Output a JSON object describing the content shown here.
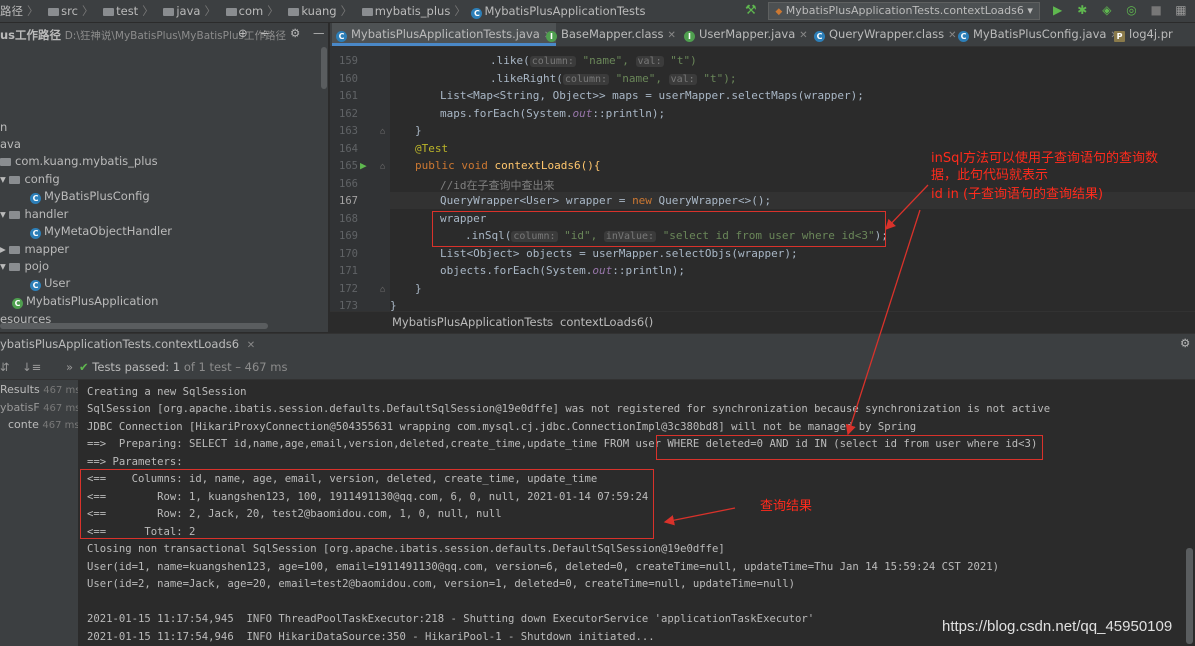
{
  "navbar": {
    "crumbs": [
      "路径",
      "src",
      "test",
      "java",
      "com",
      "kuang",
      "mybatis_plus",
      "MybatisPlusApplicationTests"
    ],
    "run_config": "MybatisPlusApplicationTests.contextLoads6"
  },
  "project": {
    "header": "us工作路径",
    "header_path": "D:\\狂神说\\MyBatisPlus\\MyBatisPlus工作路径",
    "items": [
      "n",
      "ava",
      "com.kuang.mybatis_plus",
      "config",
      "MyBatisPlusConfig",
      "handler",
      "MyMetaObjectHandler",
      "mapper",
      "pojo",
      "User",
      "MybatisPlusApplication",
      "esources"
    ]
  },
  "tabs": [
    {
      "label": "MybatisPlusApplicationTests.java",
      "icon": "C"
    },
    {
      "label": "BaseMapper.class",
      "icon": "I"
    },
    {
      "label": "UserMapper.java",
      "icon": "I"
    },
    {
      "label": "QueryWrapper.class",
      "icon": "C"
    },
    {
      "label": "MyBatisPlusConfig.java",
      "icon": "C"
    },
    {
      "label": "log4j.pr",
      "icon": "P"
    }
  ],
  "editor": {
    "line_numbers": [
      "159",
      "160",
      "161",
      "162",
      "163",
      "164",
      "165",
      "166",
      "167",
      "168",
      "169",
      "170",
      "171",
      "172",
      "173"
    ],
    "lines": {
      "l159a": ".like(",
      "l159h": "column:",
      "l159s1": "\"name\",",
      "l159h2": "val:",
      "l159s2": "\"t\")",
      "l160a": ".likeRight(",
      "l160h": "column:",
      "l160s1": "\"name\",",
      "l160h2": "val:",
      "l160s2": "\"t\");",
      "l161": "List<Map<String, Object>> maps = userMapper.selectMaps(wrapper);",
      "l162a": "maps.forEach(System.",
      "l162f": "out",
      "l162b": "::println);",
      "l163": "}",
      "l164": "@Test",
      "l165k": "public void",
      "l165": " contextLoads6(){",
      "l166": "//id在子查询中查出来",
      "l167a": "QueryWrapper<User> wrapper = ",
      "l167k": "new",
      "l167b": " QueryWrapper<>();",
      "l168": "wrapper",
      "l169a": ".inSql(",
      "l169h": "column:",
      "l169s1": "\"id\",",
      "l169h2": "inValue:",
      "l169s2": "\"select id from user where id<3\"",
      "l169b": ");",
      "l170": "List<Object> objects = userMapper.selectObjs(wrapper);",
      "l171a": "objects.forEach(System.",
      "l171f": "out",
      "l171b": "::println);",
      "l172": "}",
      "l173": "}"
    },
    "breadcrumb": [
      "MybatisPlusApplicationTests",
      "contextLoads6()"
    ]
  },
  "annotation": {
    "line1": "inSql方法可以使用子查询语句的查询数",
    "line2": "据，此句代码就表示",
    "line3": "id in (子查询语句的查询结果)",
    "result_label": "查询结果"
  },
  "run": {
    "tab": "ybatisPlusApplicationTests.contextLoads6",
    "status_label": "Tests passed:",
    "status_count": "1",
    "status_rest": "of 1 test – 467 ms",
    "tree": [
      {
        "label": "Results",
        "time": "467 ms"
      },
      {
        "label": "ybatisF",
        "time": "467 ms"
      },
      {
        "label": "conte",
        "time": "467 ms"
      }
    ]
  },
  "console": [
    "Creating a new SqlSession",
    "SqlSession [org.apache.ibatis.session.defaults.DefaultSqlSession@19e0dffe] was not registered for synchronization because synchronization is not active",
    "JDBC Connection [HikariProxyConnection@504355631 wrapping com.mysql.cj.jdbc.ConnectionImpl@3c380bd8] will not be managed by Spring",
    "==>  Preparing: SELECT id,name,age,email,version,deleted,create_time,update_time FROM user WHERE deleted=0 AND id IN (select id from user where id<3)",
    "==> Parameters: ",
    "<==    Columns: id, name, age, email, version, deleted, create_time, update_time",
    "<==        Row: 1, kuangshen123, 100, 1911491130@qq.com, 6, 0, null, 2021-01-14 07:59:24",
    "<==        Row: 2, Jack, 20, test2@baomidou.com, 1, 0, null, null",
    "<==      Total: 2",
    "Closing non transactional SqlSession [org.apache.ibatis.session.defaults.DefaultSqlSession@19e0dffe]",
    "User(id=1, name=kuangshen123, age=100, email=1911491130@qq.com, version=6, deleted=0, createTime=null, updateTime=Thu Jan 14 15:59:24 CST 2021)",
    "User(id=2, name=Jack, age=20, email=test2@baomidou.com, version=1, deleted=0, createTime=null, updateTime=null)",
    "",
    "2021-01-15 11:17:54,945  INFO ThreadPoolTaskExecutor:218 - Shutting down ExecutorService 'applicationTaskExecutor'",
    "2021-01-15 11:17:54,946  INFO HikariDataSource:350 - HikariPool-1 - Shutdown initiated..."
  ],
  "watermark": "https://blog.csdn.net/qq_45950109",
  "colors": {
    "accent": "#4a88c7",
    "annotation_red": "#ff2b1c",
    "pass_green": "#5fb84f"
  }
}
